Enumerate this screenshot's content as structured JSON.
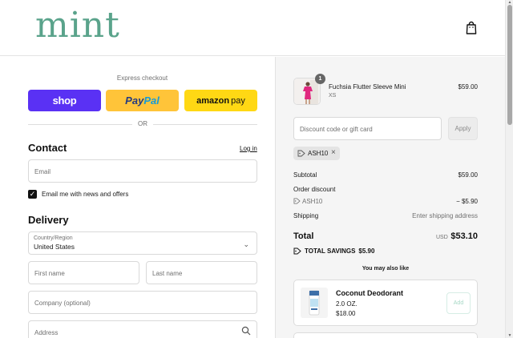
{
  "header": {
    "logo": "mint",
    "cart_icon": "shopping-bag-icon"
  },
  "express": {
    "label": "Express checkout",
    "shop_label": "shop",
    "paypal_label_1": "Pay",
    "paypal_label_2": "Pal",
    "amazon_label_1": "amazon",
    "amazon_label_2": "pay",
    "or_label": "OR"
  },
  "contact": {
    "title": "Contact",
    "login_label": "Log in",
    "email_placeholder": "Email",
    "newsletter_label": "Email me with news and offers",
    "newsletter_checked": true
  },
  "delivery": {
    "title": "Delivery",
    "country_label": "Country/Region",
    "country_value": "United States",
    "first_name_placeholder": "First name",
    "last_name_placeholder": "Last name",
    "company_placeholder": "Company (optional)",
    "address_placeholder": "Address"
  },
  "order": {
    "product": {
      "name": "Fuchsia Flutter Sleeve Mini",
      "variant": "XS",
      "price": "$59.00",
      "quantity": "1"
    },
    "discount_placeholder": "Discount code or gift card",
    "apply_label": "Apply",
    "applied_code": "ASH10",
    "subtotal_label": "Subtotal",
    "subtotal_value": "$59.00",
    "order_discount_label": "Order discount",
    "discount_code": "ASH10",
    "discount_value": "− $5.90",
    "shipping_label": "Shipping",
    "shipping_value": "Enter shipping address",
    "total_label": "Total",
    "total_currency": "USD",
    "total_value": "$53.10",
    "savings_label": "TOTAL SAVINGS",
    "savings_value": "$5.90",
    "also_like_label": "You may also like",
    "upsell": {
      "name": "Coconut Deodorant",
      "size": "2.0 OZ.",
      "price": "$18.00",
      "add_label": "Add"
    }
  },
  "colors": {
    "brand": "#5aa38b",
    "shop_pay": "#5a31f4",
    "paypal": "#ffc439",
    "amazon_pay": "#ffd814"
  }
}
